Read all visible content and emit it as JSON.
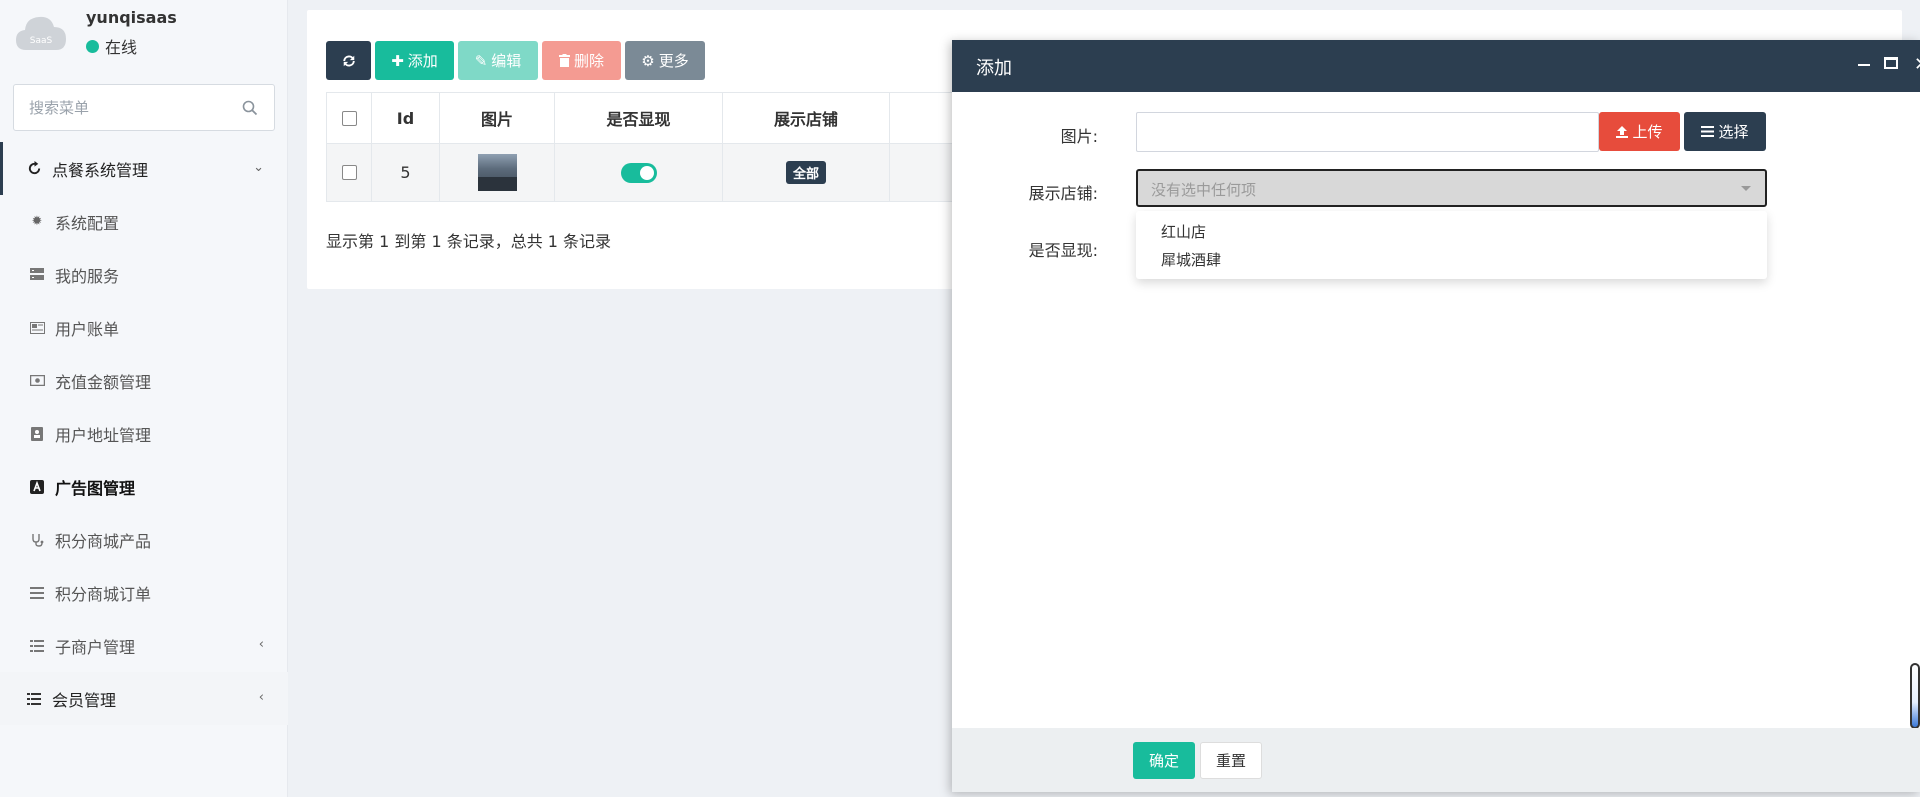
{
  "user": {
    "avatar_text": "SaaS",
    "name": "yunqisaas",
    "status": "在线"
  },
  "search": {
    "placeholder": "搜索菜单"
  },
  "menu": {
    "parent_label": "点餐系统管理",
    "items": [
      {
        "label": "系统配置",
        "icon": "gear-icon"
      },
      {
        "label": "我的服务",
        "icon": "server-icon"
      },
      {
        "label": "用户账单",
        "icon": "newspaper-icon"
      },
      {
        "label": "充值金额管理",
        "icon": "money-icon"
      },
      {
        "label": "用户地址管理",
        "icon": "address-book-icon"
      },
      {
        "label": "广告图管理",
        "icon": "ad-icon",
        "active": true
      },
      {
        "label": "积分商城产品",
        "icon": "stethoscope-icon"
      },
      {
        "label": "积分商城订单",
        "icon": "bars-icon"
      },
      {
        "label": "子商户管理",
        "icon": "list-icon"
      }
    ],
    "member_label": "会员管理"
  },
  "toolbar": {
    "add_label": "添加",
    "edit_label": "编辑",
    "delete_label": "删除",
    "more_label": "更多"
  },
  "table": {
    "headers": [
      "Id",
      "图片",
      "是否显现",
      "展示店铺"
    ],
    "rows": [
      {
        "id": "5",
        "show": true,
        "store_badge": "全部"
      }
    ],
    "pager": "显示第 1 到第 1 条记录，总共 1 条记录"
  },
  "modal": {
    "title": "添加",
    "image_label": "图片:",
    "upload_label": "上传",
    "choose_label": "选择",
    "store_label": "展示店铺:",
    "store_placeholder": "没有选中任何项",
    "show_label": "是否显现:",
    "store_options": [
      "红山店",
      "犀城酒肆"
    ],
    "ok_label": "确定",
    "reset_label": "重置"
  },
  "colors": {
    "primary": "#2c3e50",
    "success": "#18bc9c",
    "danger": "#e74c3c"
  }
}
